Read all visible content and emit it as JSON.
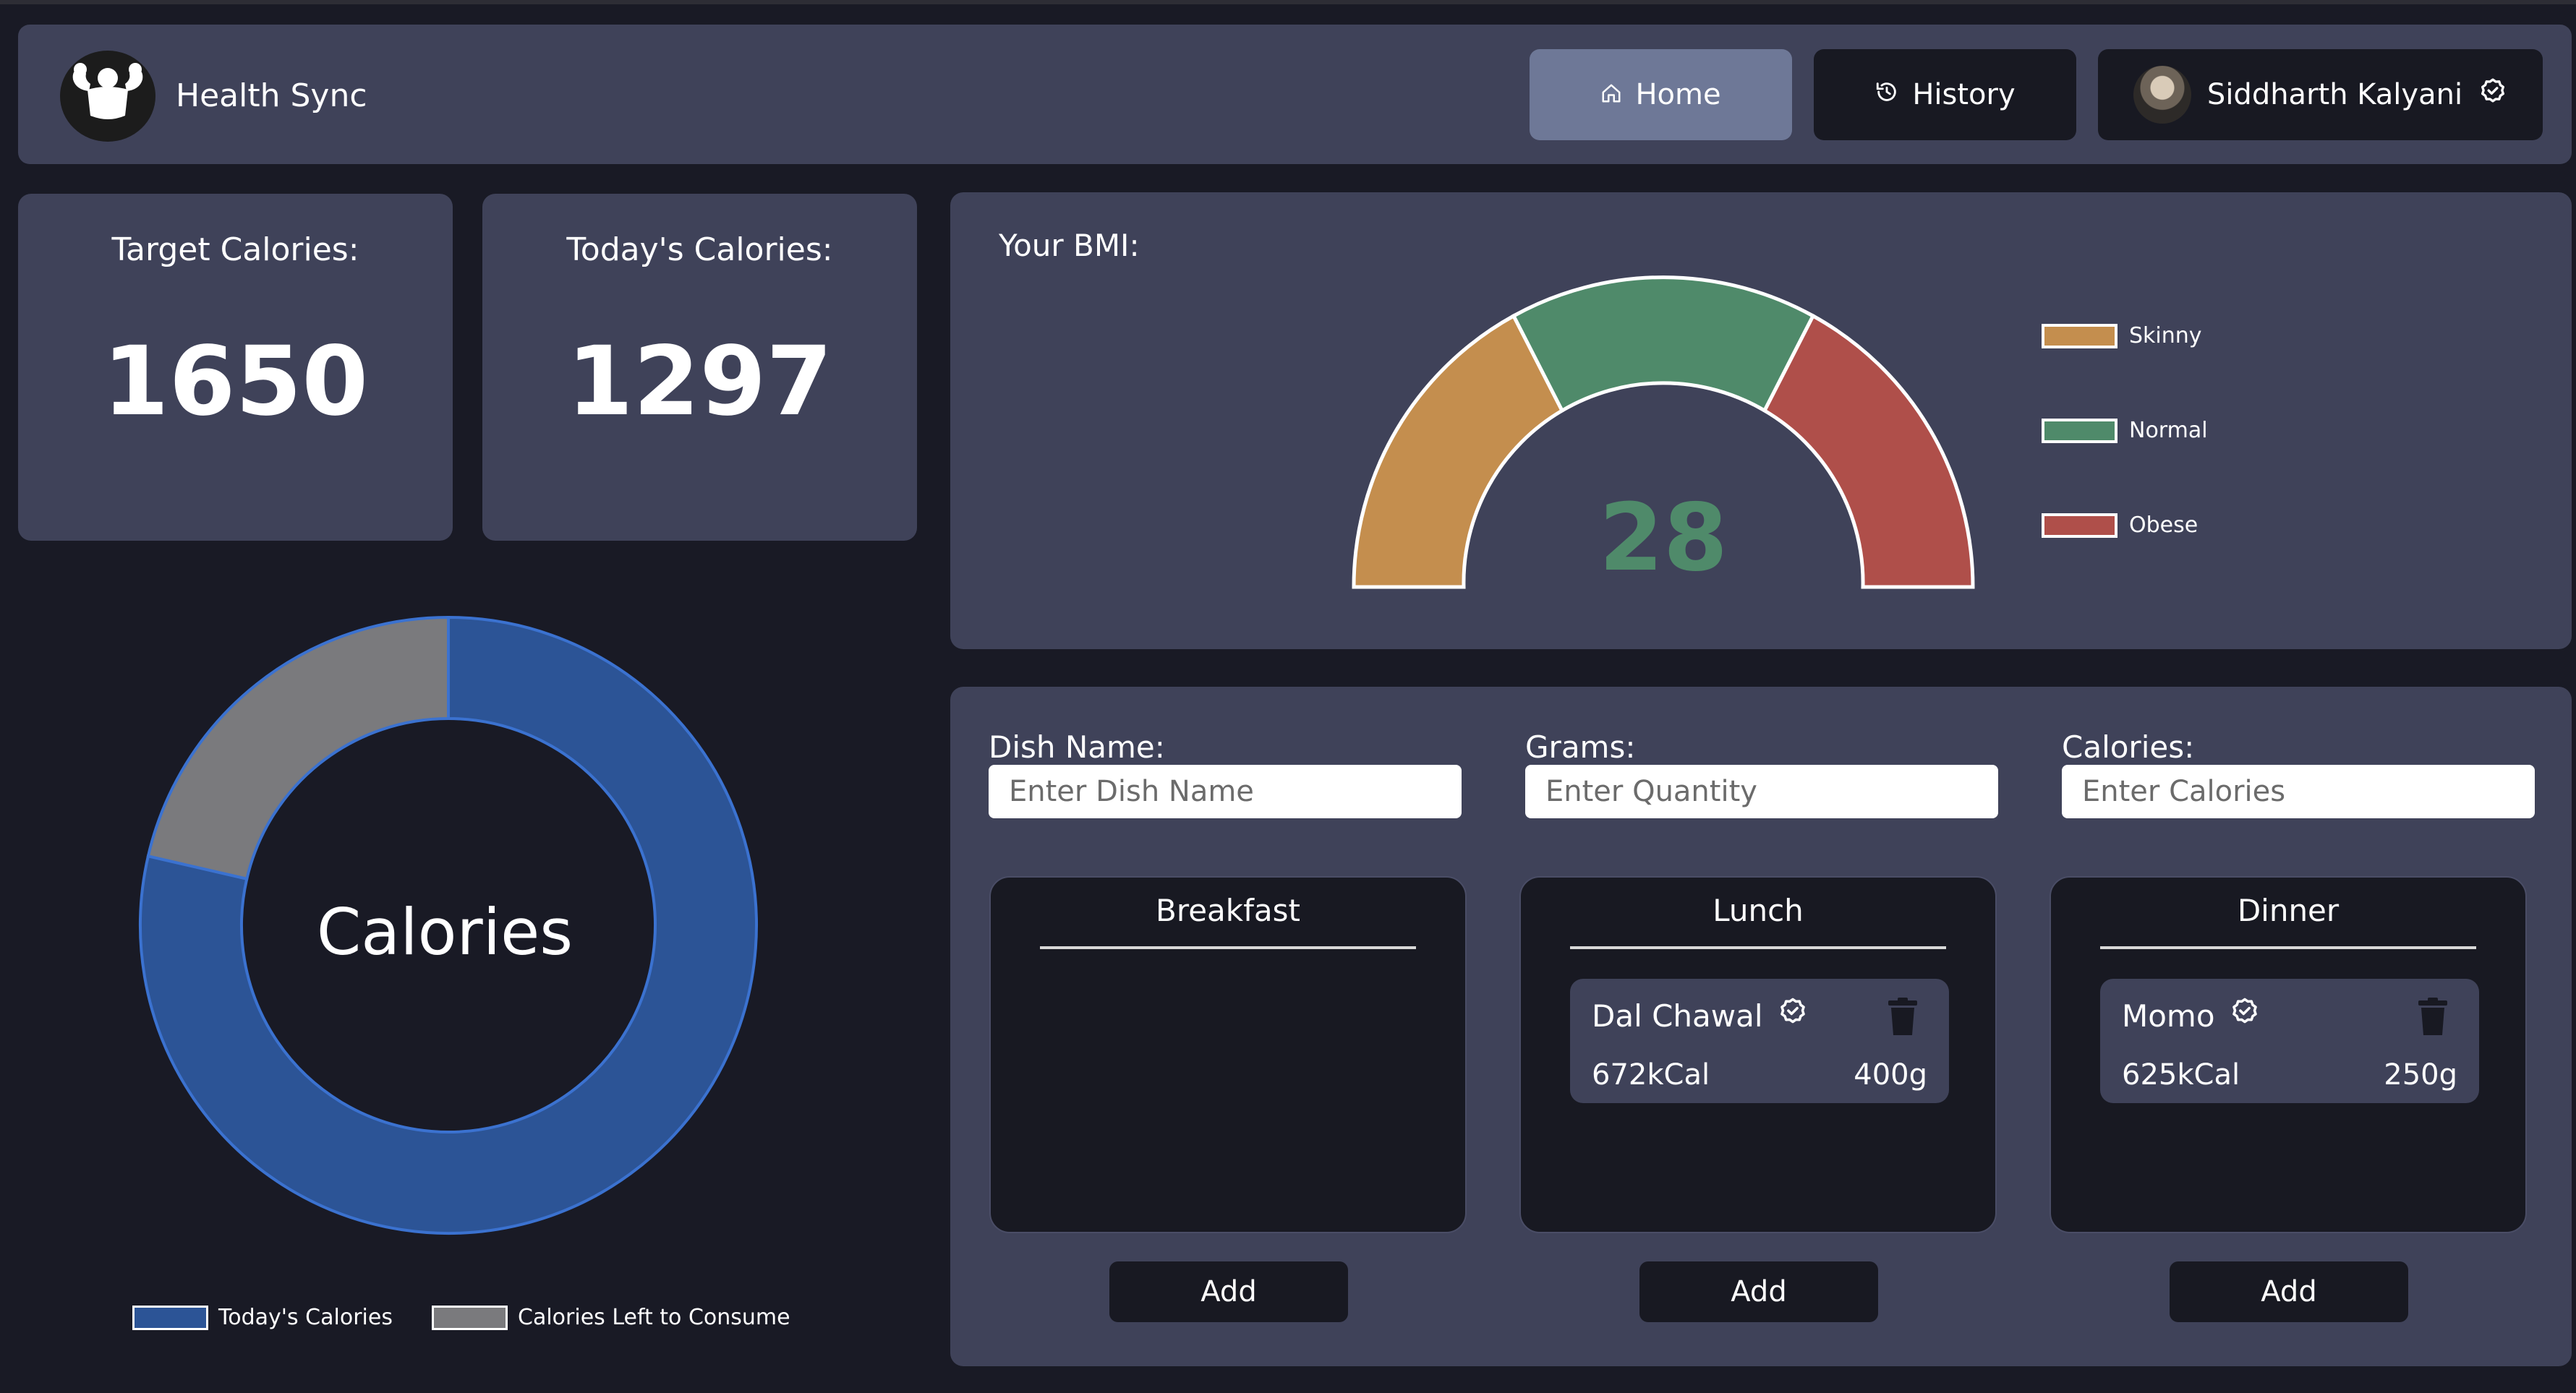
{
  "app": {
    "name": "Health Sync"
  },
  "nav": {
    "home": "Home",
    "history": "History",
    "user": "Siddharth Kalyani"
  },
  "stats": {
    "target_label": "Target Calories:",
    "target_value": "1650",
    "today_label": "Today's Calories:",
    "today_value": "1297"
  },
  "bmi": {
    "title": "Your BMI:",
    "value": "28",
    "legend": [
      "Skinny",
      "Normal",
      "Obese"
    ],
    "colors": {
      "skinny": "#c48e4e",
      "normal": "#4f8a6a",
      "obese": "#af4f4a"
    }
  },
  "calories_chart": {
    "center_label": "Calories",
    "legend": [
      "Today's Calories",
      "Calories Left to Consume"
    ],
    "colors": {
      "today": "#2c5496",
      "left": "#7a7a7d"
    }
  },
  "chart_data": {
    "type": "pie",
    "categories": [
      "Today's Calories",
      "Calories Left to Consume"
    ],
    "values": [
      1297,
      353
    ],
    "title": "Calories",
    "legend": "bottom"
  },
  "form": {
    "dish_label": "Dish Name:",
    "dish_placeholder": "Enter Dish Name",
    "grams_label": "Grams:",
    "grams_placeholder": "Enter Quantity",
    "calories_label": "Calories:",
    "calories_placeholder": "Enter Calories"
  },
  "meals": {
    "breakfast": {
      "title": "Breakfast",
      "add": "Add"
    },
    "lunch": {
      "title": "Lunch",
      "add": "Add",
      "item": {
        "name": "Dal Chawal",
        "kcal": "672kCal",
        "grams": "400g"
      }
    },
    "dinner": {
      "title": "Dinner",
      "add": "Add",
      "item": {
        "name": "Momo",
        "kcal": "625kCal",
        "grams": "250g"
      }
    }
  },
  "icons": {
    "logo": "muscle-logo-icon",
    "home": "home-icon",
    "history": "history-icon",
    "verified": "check-circle-icon",
    "delete": "trash-icon"
  }
}
